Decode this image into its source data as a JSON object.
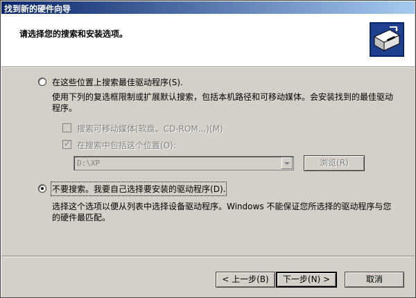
{
  "window": {
    "title": "找到新的硬件向导"
  },
  "header": {
    "title": "请选择您的搜索和安装选项。",
    "icon": "hardware-install-icon"
  },
  "option_search": {
    "label": "在这些位置上搜索最佳驱动程序",
    "hotkey": "(S).",
    "checked": false,
    "description": "使用下列的复选框限制或扩展默认搜索，包括本机路径和可移动媒体。会安装找到的最佳驱动程序。"
  },
  "search_removable": {
    "label": "搜索可移动媒体(软盘、CD-ROM...)",
    "hotkey": "(M)",
    "checked": false,
    "enabled": false
  },
  "include_location": {
    "label": "在搜索中包括这个位置",
    "hotkey": "(O):",
    "checked": true,
    "enabled": false
  },
  "location_combo": {
    "value": "D:\\XP",
    "enabled": false
  },
  "browse_button": {
    "label": "浏览",
    "hotkey": "(R)",
    "enabled": false
  },
  "option_manual": {
    "label": "不要搜索。我要自己选择要安装的驱动程序",
    "hotkey": "(D).",
    "checked": true,
    "description": "选择这个选项以便从列表中选择设备驱动程序。Windows 不能保证您所选择的驱动程序与您的硬件最匹配。"
  },
  "footer": {
    "back_label": "< 上一步",
    "back_hotkey": "(B)",
    "next_label": "下一步",
    "next_hotkey": "(N) >",
    "cancel_label": "取消"
  },
  "colors": {
    "title_start": "#0a246a",
    "title_end": "#a6caf0",
    "face": "#d4d0c8"
  }
}
